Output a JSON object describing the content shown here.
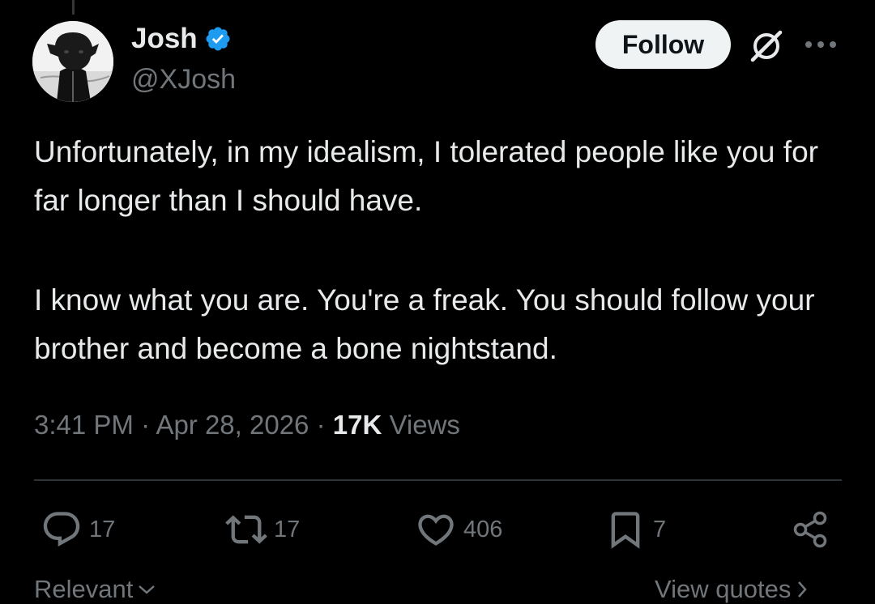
{
  "author": {
    "display_name": "Josh",
    "handle": "@XJosh",
    "verified": true
  },
  "follow_label": "Follow",
  "tweet": {
    "paragraphs": [
      "Unfortunately, in my idealism, I tolerated people like you for far longer than I should have.",
      "I know what you are. You're a freak. You should follow your brother and become a bone nightstand."
    ]
  },
  "meta": {
    "time": "3:41 PM",
    "separator": "·",
    "date": "Apr 28, 2026",
    "views_count": "17K",
    "views_label": "Views"
  },
  "actions": {
    "replies": "17",
    "reposts": "17",
    "likes": "406",
    "bookmarks": "7"
  },
  "footer": {
    "sort_label": "Relevant",
    "quotes_label": "View quotes"
  },
  "icons": {
    "verified": "verified-badge-icon",
    "grok": "grok-icon",
    "more": "more-options-icon",
    "reply": "reply-icon",
    "repost": "repost-icon",
    "like": "heart-icon",
    "bookmark": "bookmark-icon",
    "share": "share-icon"
  },
  "colors": {
    "background": "#000000",
    "text_primary": "#e7e9ea",
    "text_secondary": "#71767b",
    "verified_blue": "#1d9bf0",
    "follow_bg": "#eff3f4",
    "divider": "#2f3336"
  }
}
